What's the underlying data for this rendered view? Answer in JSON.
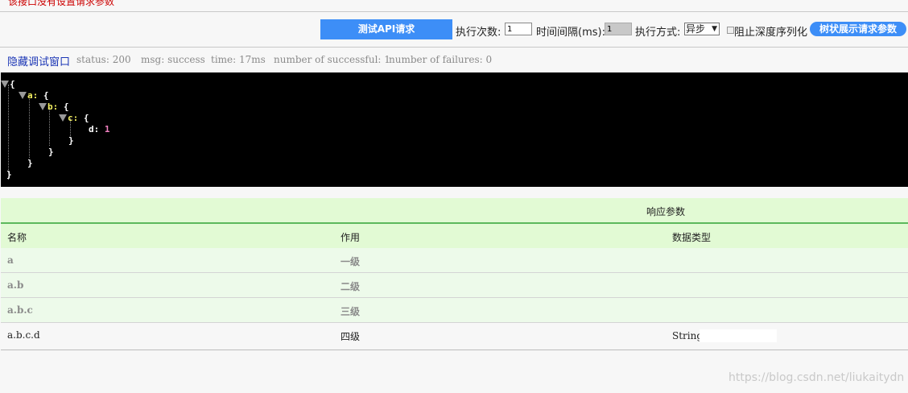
{
  "notice": {
    "text": "该接口没有设置请求参数"
  },
  "toolbar": {
    "test_button": "测试API请求",
    "count_label": "执行次数:",
    "count_value": "1",
    "interval_label": "时间间隔(ms):",
    "interval_value": "1",
    "mode_label": "执行方式:",
    "mode_value": "异步",
    "checkbox_label": "阻止深度序列化",
    "tree_button": "树状展示请求参数"
  },
  "status_bar": {
    "hide_link": "隐藏调试窗口",
    "status": "status: 200",
    "msg": "msg: success",
    "time": "time: 17ms",
    "successful": "number of successful: 1",
    "failures": "number of failures: 0"
  },
  "json_view": {
    "open_brace": "{",
    "close_brace": "}",
    "key_a": "a:",
    "key_b": "b:",
    "key_c": "c:",
    "key_d": "d:",
    "value_d": "1"
  },
  "response": {
    "title": "响应参数",
    "headers": [
      "名称",
      "作用",
      "数据类型"
    ],
    "rows": [
      {
        "name": "a",
        "desc": "一级",
        "type": ""
      },
      {
        "name": "a.b",
        "desc": "二级",
        "type": ""
      },
      {
        "name": "a.b.c",
        "desc": "三级",
        "type": ""
      },
      {
        "name": "a.b.c.d",
        "desc": "四级",
        "type": "String"
      }
    ]
  },
  "watermark": "https://blog.csdn.net/liukaitydn",
  "colors": {
    "accent": "#3d8ef7",
    "header_bg": "#e2fad4",
    "json_key": "#f4f060",
    "json_number": "#f080c0"
  }
}
